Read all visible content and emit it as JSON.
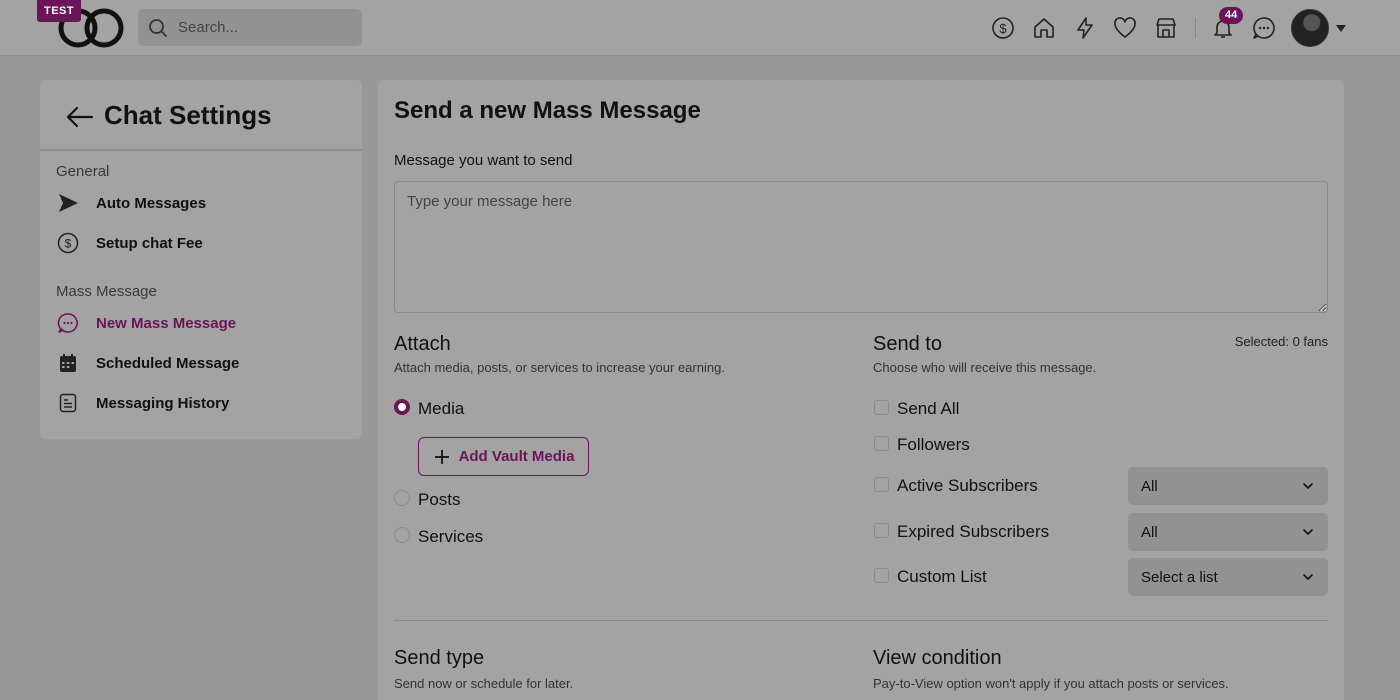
{
  "topbar": {
    "badge": "TEST",
    "search_placeholder": "Search...",
    "notifications_count": "44",
    "icons": [
      "dollar-icon",
      "home-icon",
      "bolt-icon",
      "heart-icon",
      "store-icon",
      "bell-icon",
      "chat-icon"
    ]
  },
  "sidebar": {
    "title": "Chat Settings",
    "sections": [
      {
        "label": "General",
        "items": [
          {
            "label": "Auto Messages",
            "icon": "send-icon"
          },
          {
            "label": "Setup chat Fee",
            "icon": "dollar-circle-icon"
          }
        ]
      },
      {
        "label": "Mass Message",
        "items": [
          {
            "label": "New Mass Message",
            "icon": "chat-bubble-icon",
            "active": true
          },
          {
            "label": "Scheduled Message",
            "icon": "calendar-icon"
          },
          {
            "label": "Messaging History",
            "icon": "document-icon"
          }
        ]
      }
    ]
  },
  "main": {
    "title": "Send a new Mass Message",
    "message_label": "Message you want to send",
    "message_placeholder": "Type your message here",
    "attach": {
      "title": "Attach",
      "subtitle": "Attach media, posts, or services to increase your earning.",
      "options": [
        {
          "label": "Media",
          "selected": true
        },
        {
          "label": "Posts",
          "selected": false
        },
        {
          "label": "Services",
          "selected": false
        }
      ],
      "vault_button": "Add Vault Media"
    },
    "send_to": {
      "title": "Send to",
      "subtitle": "Choose who will receive this message.",
      "selected": "Selected: 0 fans",
      "options": [
        {
          "label": "Send All"
        },
        {
          "label": "Followers"
        },
        {
          "label": "Active Subscribers",
          "select": "All"
        },
        {
          "label": "Expired Subscribers",
          "select": "All"
        },
        {
          "label": "Custom List",
          "select": "Select a list"
        }
      ]
    },
    "send_type": {
      "title": "Send type",
      "subtitle": "Send now or schedule for later."
    },
    "view_condition": {
      "title": "View condition",
      "subtitle": "Pay-to-View option won't apply if you attach posts or services."
    }
  },
  "colors": {
    "accent": "#6b1558",
    "overlay_background": "#999999"
  }
}
